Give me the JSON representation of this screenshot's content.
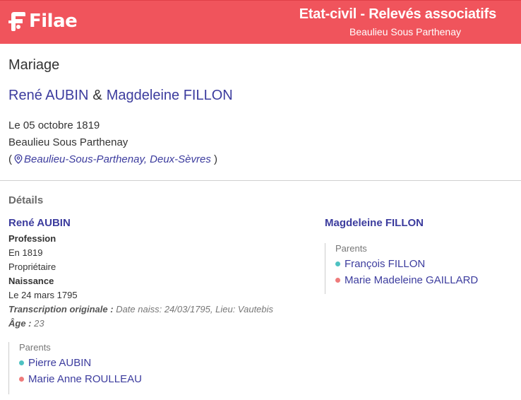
{
  "header": {
    "brand": "Filae",
    "title": "Etat-civil - Relevés associatifs",
    "subtitle": "Beaulieu Sous Parthenay",
    "color": "#f0545c"
  },
  "record": {
    "type": "Mariage",
    "spouse1": "René AUBIN",
    "amp": "&",
    "spouse2": "Magdeleine FILLON",
    "date": "Le 05 octobre 1819",
    "place": "Beaulieu Sous Parthenay",
    "open_paren": "(",
    "location_link": "Beaulieu-Sous-Parthenay, Deux-Sèvres",
    "close_paren": ")"
  },
  "details": {
    "title": "Détails",
    "person1": {
      "name": "René AUBIN",
      "profession_label": "Profession",
      "profession_year": "En 1819",
      "profession_value": "Propriétaire",
      "birth_label": "Naissance",
      "birth_date": "Le 24 mars 1795",
      "transcription_label": "Transcription originale :",
      "transcription_value": "Date naiss: 24/03/1795, Lieu: Vautebis",
      "age_label": "Âge :",
      "age_value": "23",
      "parents_label": "Parents",
      "father": "Pierre AUBIN",
      "mother": "Marie Anne ROULLEAU"
    },
    "person2": {
      "name": "Magdeleine FILLON",
      "parents_label": "Parents",
      "father": "François FILLON",
      "mother": "Marie Madeleine GAILLARD"
    }
  },
  "colors": {
    "link": "#3c3c9e",
    "male_dot": "#4ec2c2",
    "female_dot": "#ef7b7b"
  }
}
